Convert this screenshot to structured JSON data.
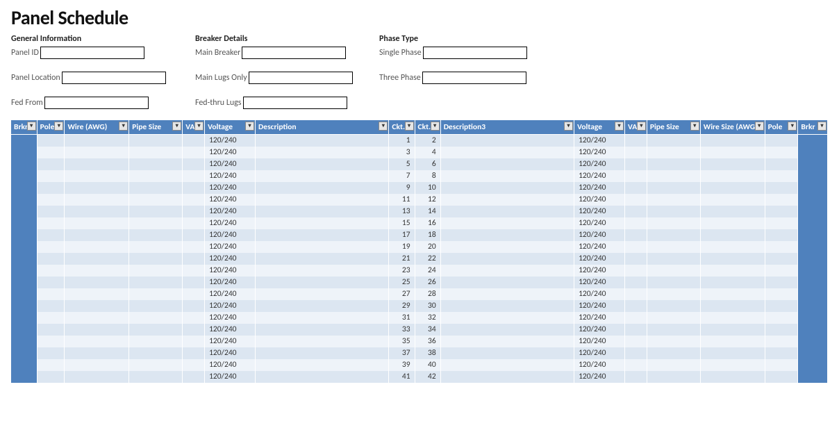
{
  "title": "Panel Schedule",
  "sections": {
    "general": {
      "heading": "General Information",
      "panel_id_label": "Panel ID",
      "panel_location_label": "Panel Location",
      "fed_from_label": "Fed From"
    },
    "breaker": {
      "heading": "Breaker Details",
      "main_breaker_label": "Main Breaker",
      "main_lugs_label": "Main Lugs Only",
      "fed_thru_label": "Fed-thru Lugs"
    },
    "phase": {
      "heading": "Phase Type",
      "single_label": "Single Phase",
      "three_label": "Three Phase"
    }
  },
  "columns": {
    "brkr": "Brkr",
    "pole": "Pole",
    "wire": "Wire (AWG)",
    "pipe": "Pipe Size",
    "va": "VA",
    "voltage": "Voltage",
    "description": "Description",
    "ckt": "Ckt.",
    "ckt2": "Ckt.",
    "description3": "Description3",
    "voltage2": "Voltage",
    "va2": "VA",
    "pipe2": "Pipe Size",
    "wire2": "Wire Size (AWG)",
    "pole2": "Pole",
    "brkr2": "Brkr"
  },
  "rows": [
    {
      "voltage": "120/240",
      "ckt": 1,
      "ckt2": 2,
      "voltage2": "120/240"
    },
    {
      "voltage": "120/240",
      "ckt": 3,
      "ckt2": 4,
      "voltage2": "120/240"
    },
    {
      "voltage": "120/240",
      "ckt": 5,
      "ckt2": 6,
      "voltage2": "120/240"
    },
    {
      "voltage": "120/240",
      "ckt": 7,
      "ckt2": 8,
      "voltage2": "120/240"
    },
    {
      "voltage": "120/240",
      "ckt": 9,
      "ckt2": 10,
      "voltage2": "120/240"
    },
    {
      "voltage": "120/240",
      "ckt": 11,
      "ckt2": 12,
      "voltage2": "120/240"
    },
    {
      "voltage": "120/240",
      "ckt": 13,
      "ckt2": 14,
      "voltage2": "120/240"
    },
    {
      "voltage": "120/240",
      "ckt": 15,
      "ckt2": 16,
      "voltage2": "120/240"
    },
    {
      "voltage": "120/240",
      "ckt": 17,
      "ckt2": 18,
      "voltage2": "120/240"
    },
    {
      "voltage": "120/240",
      "ckt": 19,
      "ckt2": 20,
      "voltage2": "120/240"
    },
    {
      "voltage": "120/240",
      "ckt": 21,
      "ckt2": 22,
      "voltage2": "120/240"
    },
    {
      "voltage": "120/240",
      "ckt": 23,
      "ckt2": 24,
      "voltage2": "120/240"
    },
    {
      "voltage": "120/240",
      "ckt": 25,
      "ckt2": 26,
      "voltage2": "120/240"
    },
    {
      "voltage": "120/240",
      "ckt": 27,
      "ckt2": 28,
      "voltage2": "120/240"
    },
    {
      "voltage": "120/240",
      "ckt": 29,
      "ckt2": 30,
      "voltage2": "120/240"
    },
    {
      "voltage": "120/240",
      "ckt": 31,
      "ckt2": 32,
      "voltage2": "120/240"
    },
    {
      "voltage": "120/240",
      "ckt": 33,
      "ckt2": 34,
      "voltage2": "120/240"
    },
    {
      "voltage": "120/240",
      "ckt": 35,
      "ckt2": 36,
      "voltage2": "120/240"
    },
    {
      "voltage": "120/240",
      "ckt": 37,
      "ckt2": 38,
      "voltage2": "120/240"
    },
    {
      "voltage": "120/240",
      "ckt": 39,
      "ckt2": 40,
      "voltage2": "120/240"
    },
    {
      "voltage": "120/240",
      "ckt": 41,
      "ckt2": 42,
      "voltage2": "120/240"
    }
  ]
}
